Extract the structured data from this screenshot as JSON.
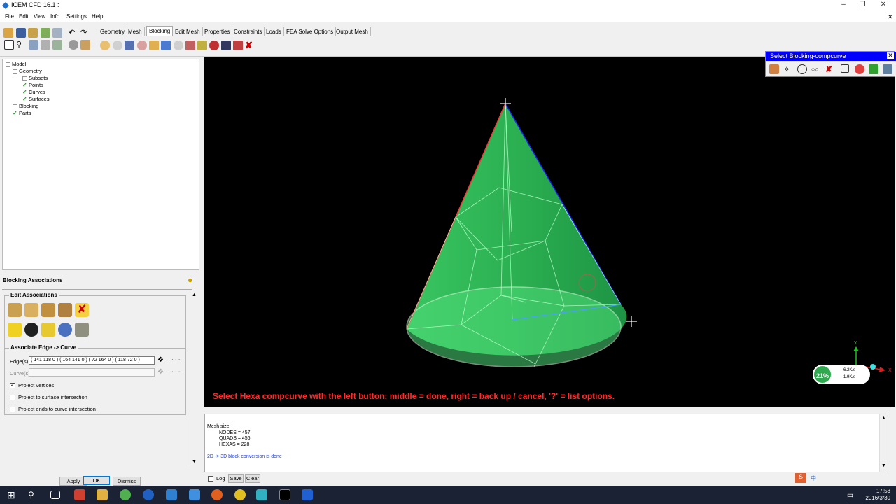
{
  "window": {
    "title": "ICEM CFD 16.1 :"
  },
  "menu": [
    "File",
    "Edit",
    "View",
    "Info",
    "Settings",
    "Help"
  ],
  "tabs": [
    "Geometry",
    "Mesh",
    "Blocking",
    "Edit Mesh",
    "Properties",
    "Constraints",
    "Loads",
    "FEA Solve Options",
    "Output Mesh"
  ],
  "active_tab": "Blocking",
  "tree": {
    "model": "Model",
    "geometry": "Geometry",
    "subsets": "Subsets",
    "points": "Points",
    "curves": "Curves",
    "surfaces": "Surfaces",
    "blocking": "Blocking",
    "parts": "Parts"
  },
  "assoc": {
    "title": "Blocking Associations",
    "edit_group": "Edit Associations",
    "edge_group": "Associate Edge -> Curve",
    "edges_label": "Edge(s)",
    "edges_value": "( 141 118 0 ) ( 164 141 0 ) ( 72 164 0 ) ( 118 72 0 )",
    "curves_label": "Curve(s)",
    "curves_value": "",
    "project_vertices": "Project vertices",
    "project_surface": "Project to surface intersection",
    "project_ends": "Project ends to curve intersection",
    "apply": "Apply",
    "ok": "OK",
    "dismiss": "Dismiss"
  },
  "select_panel": {
    "title": "Select Blocking-compcurve"
  },
  "viewport": {
    "prompt": "Select Hexa compcurve with the left button; middle = done, right = back up / cancel, '?' = list options.",
    "monitor_pct": "21%",
    "net_up": "6.2K/s",
    "net_down": "1.9K/s",
    "axis_y": "Y",
    "axis_x": "X"
  },
  "messages": {
    "l1": "Mesh size:",
    "l2": "NODES = 457",
    "l3": "QUADS = 456",
    "l4": "HEXAS = 228",
    "l5": "2D -> 3D block conversion is done",
    "log": "Log",
    "save": "Save",
    "clear": "Clear"
  },
  "taskbar": {
    "time": "17:53",
    "date": "2016/3/30",
    "ime": "中"
  },
  "colors": {
    "cone": "#2ecc5a",
    "prompt": "#ff2a2a",
    "selhdr": "#0000ff"
  }
}
